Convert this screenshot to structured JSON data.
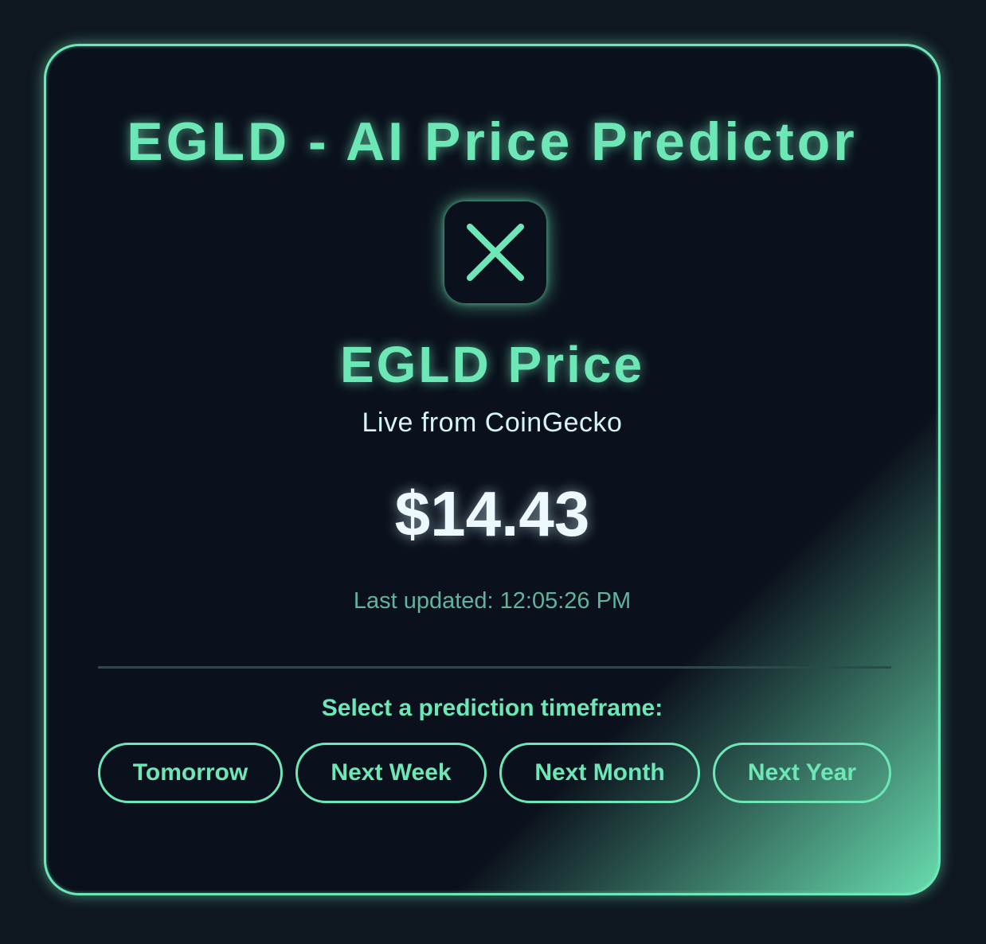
{
  "header": {
    "title": "EGLD - AI Price Predictor"
  },
  "logo": {
    "icon": "x-close-icon"
  },
  "price_card": {
    "heading": "EGLD Price",
    "source": "Live from CoinGecko",
    "price": "$14.43",
    "last_updated": "Last updated: 12:05:26 PM"
  },
  "timeframe": {
    "prompt": "Select a prediction timeframe:",
    "options": [
      {
        "label": "Tomorrow"
      },
      {
        "label": "Next Week"
      },
      {
        "label": "Next Month"
      },
      {
        "label": "Next Year"
      }
    ]
  },
  "colors": {
    "accent": "#6ee7b7",
    "background": "#0f1720",
    "card": "#0b111c",
    "price_text": "#eef8ff",
    "muted": "#61b39b"
  }
}
